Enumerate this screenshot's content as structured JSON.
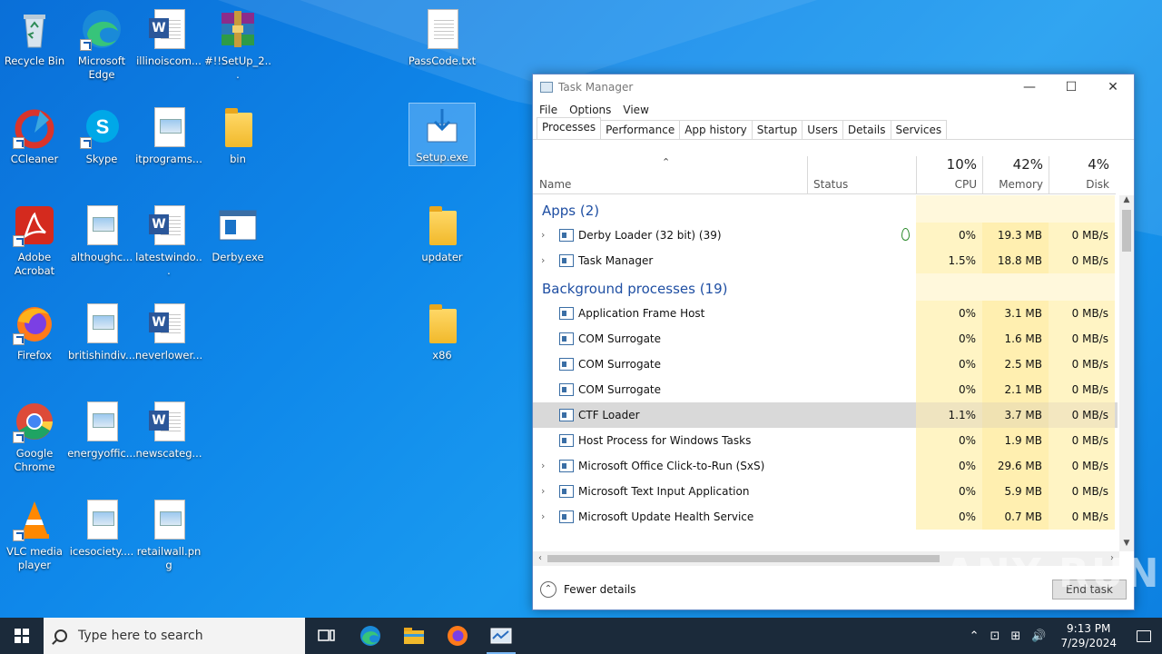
{
  "desktop": {
    "icons": [
      {
        "label": "Recycle Bin",
        "icon": "recycle-bin-icon"
      },
      {
        "label": "Microsoft Edge",
        "icon": "edge-icon"
      },
      {
        "label": "illinoiscom...",
        "icon": "word-doc-icon"
      },
      {
        "label": "#!!SetUp_2...",
        "icon": "winrar-icon"
      },
      {
        "label": "PassCode.txt",
        "icon": "text-file-icon"
      },
      {
        "label": "CCleaner",
        "icon": "ccleaner-icon"
      },
      {
        "label": "Skype",
        "icon": "skype-icon"
      },
      {
        "label": "itprograms...",
        "icon": "image-file-icon"
      },
      {
        "label": "bin",
        "icon": "folder-icon"
      },
      {
        "label": "Setup.exe",
        "icon": "setup-installer-icon"
      },
      {
        "label": "Adobe Acrobat",
        "icon": "acrobat-icon"
      },
      {
        "label": "althoughc...",
        "icon": "image-file-icon"
      },
      {
        "label": "latestwindo...",
        "icon": "word-doc-icon"
      },
      {
        "label": "Derby.exe",
        "icon": "exe-app-icon"
      },
      {
        "label": "updater",
        "icon": "folder-icon"
      },
      {
        "label": "Firefox",
        "icon": "firefox-icon"
      },
      {
        "label": "britishindiv...",
        "icon": "image-file-icon"
      },
      {
        "label": "neverlower...",
        "icon": "word-doc-icon"
      },
      {
        "label": "x86",
        "icon": "folder-icon"
      },
      {
        "label": "Google Chrome",
        "icon": "chrome-icon"
      },
      {
        "label": "energyoffic...",
        "icon": "image-file-icon"
      },
      {
        "label": "newscateg...",
        "icon": "word-doc-icon"
      },
      {
        "label": "VLC media player",
        "icon": "vlc-icon"
      },
      {
        "label": "icesociety....",
        "icon": "image-file-icon"
      },
      {
        "label": "retailwall.png",
        "icon": "image-file-icon"
      }
    ]
  },
  "taskmanager": {
    "title": "Task Manager",
    "controls": {
      "minimize": "—",
      "maximize": "☐",
      "close": "✕"
    },
    "menu": [
      "File",
      "Options",
      "View"
    ],
    "tabs": [
      "Processes",
      "Performance",
      "App history",
      "Startup",
      "Users",
      "Details",
      "Services"
    ],
    "active_tab": "Processes",
    "columns": {
      "name": "Name",
      "status": "Status",
      "cpu": {
        "pct": "10%",
        "label": "CPU"
      },
      "memory": {
        "pct": "42%",
        "label": "Memory"
      },
      "disk": {
        "pct": "4%",
        "label": "Disk"
      }
    },
    "groups": [
      {
        "name": "Apps (2)",
        "rows": [
          {
            "name": "Derby Loader (32 bit) (39)",
            "expandable": true,
            "icon": "derby-loader-icon",
            "leaf": true,
            "cpu": "0%",
            "memory": "19.3 MB",
            "disk": "0 MB/s"
          },
          {
            "name": "Task Manager",
            "expandable": true,
            "icon": "task-manager-icon",
            "cpu": "1.5%",
            "memory": "18.8 MB",
            "disk": "0 MB/s"
          }
        ]
      },
      {
        "name": "Background processes (19)",
        "rows": [
          {
            "name": "Application Frame Host",
            "expandable": false,
            "icon": "process-window-icon",
            "cpu": "0%",
            "memory": "3.1 MB",
            "disk": "0 MB/s"
          },
          {
            "name": "COM Surrogate",
            "expandable": false,
            "icon": "process-window-icon",
            "cpu": "0%",
            "memory": "1.6 MB",
            "disk": "0 MB/s"
          },
          {
            "name": "COM Surrogate",
            "expandable": false,
            "icon": "process-window-icon",
            "cpu": "0%",
            "memory": "2.5 MB",
            "disk": "0 MB/s"
          },
          {
            "name": "COM Surrogate",
            "expandable": false,
            "icon": "process-window-icon",
            "cpu": "0%",
            "memory": "2.1 MB",
            "disk": "0 MB/s"
          },
          {
            "name": "CTF Loader",
            "expandable": false,
            "icon": "ctf-loader-icon",
            "selected": true,
            "cpu": "1.1%",
            "memory": "3.7 MB",
            "disk": "0 MB/s"
          },
          {
            "name": "Host Process for Windows Tasks",
            "expandable": false,
            "icon": "process-window-icon",
            "cpu": "0%",
            "memory": "1.9 MB",
            "disk": "0 MB/s"
          },
          {
            "name": "Microsoft Office Click-to-Run (SxS)",
            "expandable": true,
            "icon": "office-icon",
            "cpu": "0%",
            "memory": "29.6 MB",
            "disk": "0 MB/s"
          },
          {
            "name": "Microsoft Text Input Application",
            "expandable": true,
            "icon": "process-window-icon",
            "cpu": "0%",
            "memory": "5.9 MB",
            "disk": "0 MB/s"
          },
          {
            "name": "Microsoft Update Health Service",
            "expandable": true,
            "icon": "process-window-icon",
            "cpu": "0%",
            "memory": "0.7 MB",
            "disk": "0 MB/s"
          }
        ]
      }
    ],
    "footer": {
      "fewer_details": "Fewer details",
      "end_task": "End task"
    }
  },
  "watermark": "ANY RUN",
  "taskbar": {
    "search_placeholder": "Type here to search",
    "pinned": [
      "task-view-icon",
      "edge-icon",
      "file-explorer-icon",
      "firefox-icon",
      "task-manager-icon"
    ],
    "clock_time": "9:13 PM",
    "clock_date": "7/29/2024"
  },
  "colors": {
    "accent": "#1f4fa3",
    "desktop": "#0f88ea",
    "taskbar": "#1b2a3a",
    "heat": "#fff4c4"
  }
}
